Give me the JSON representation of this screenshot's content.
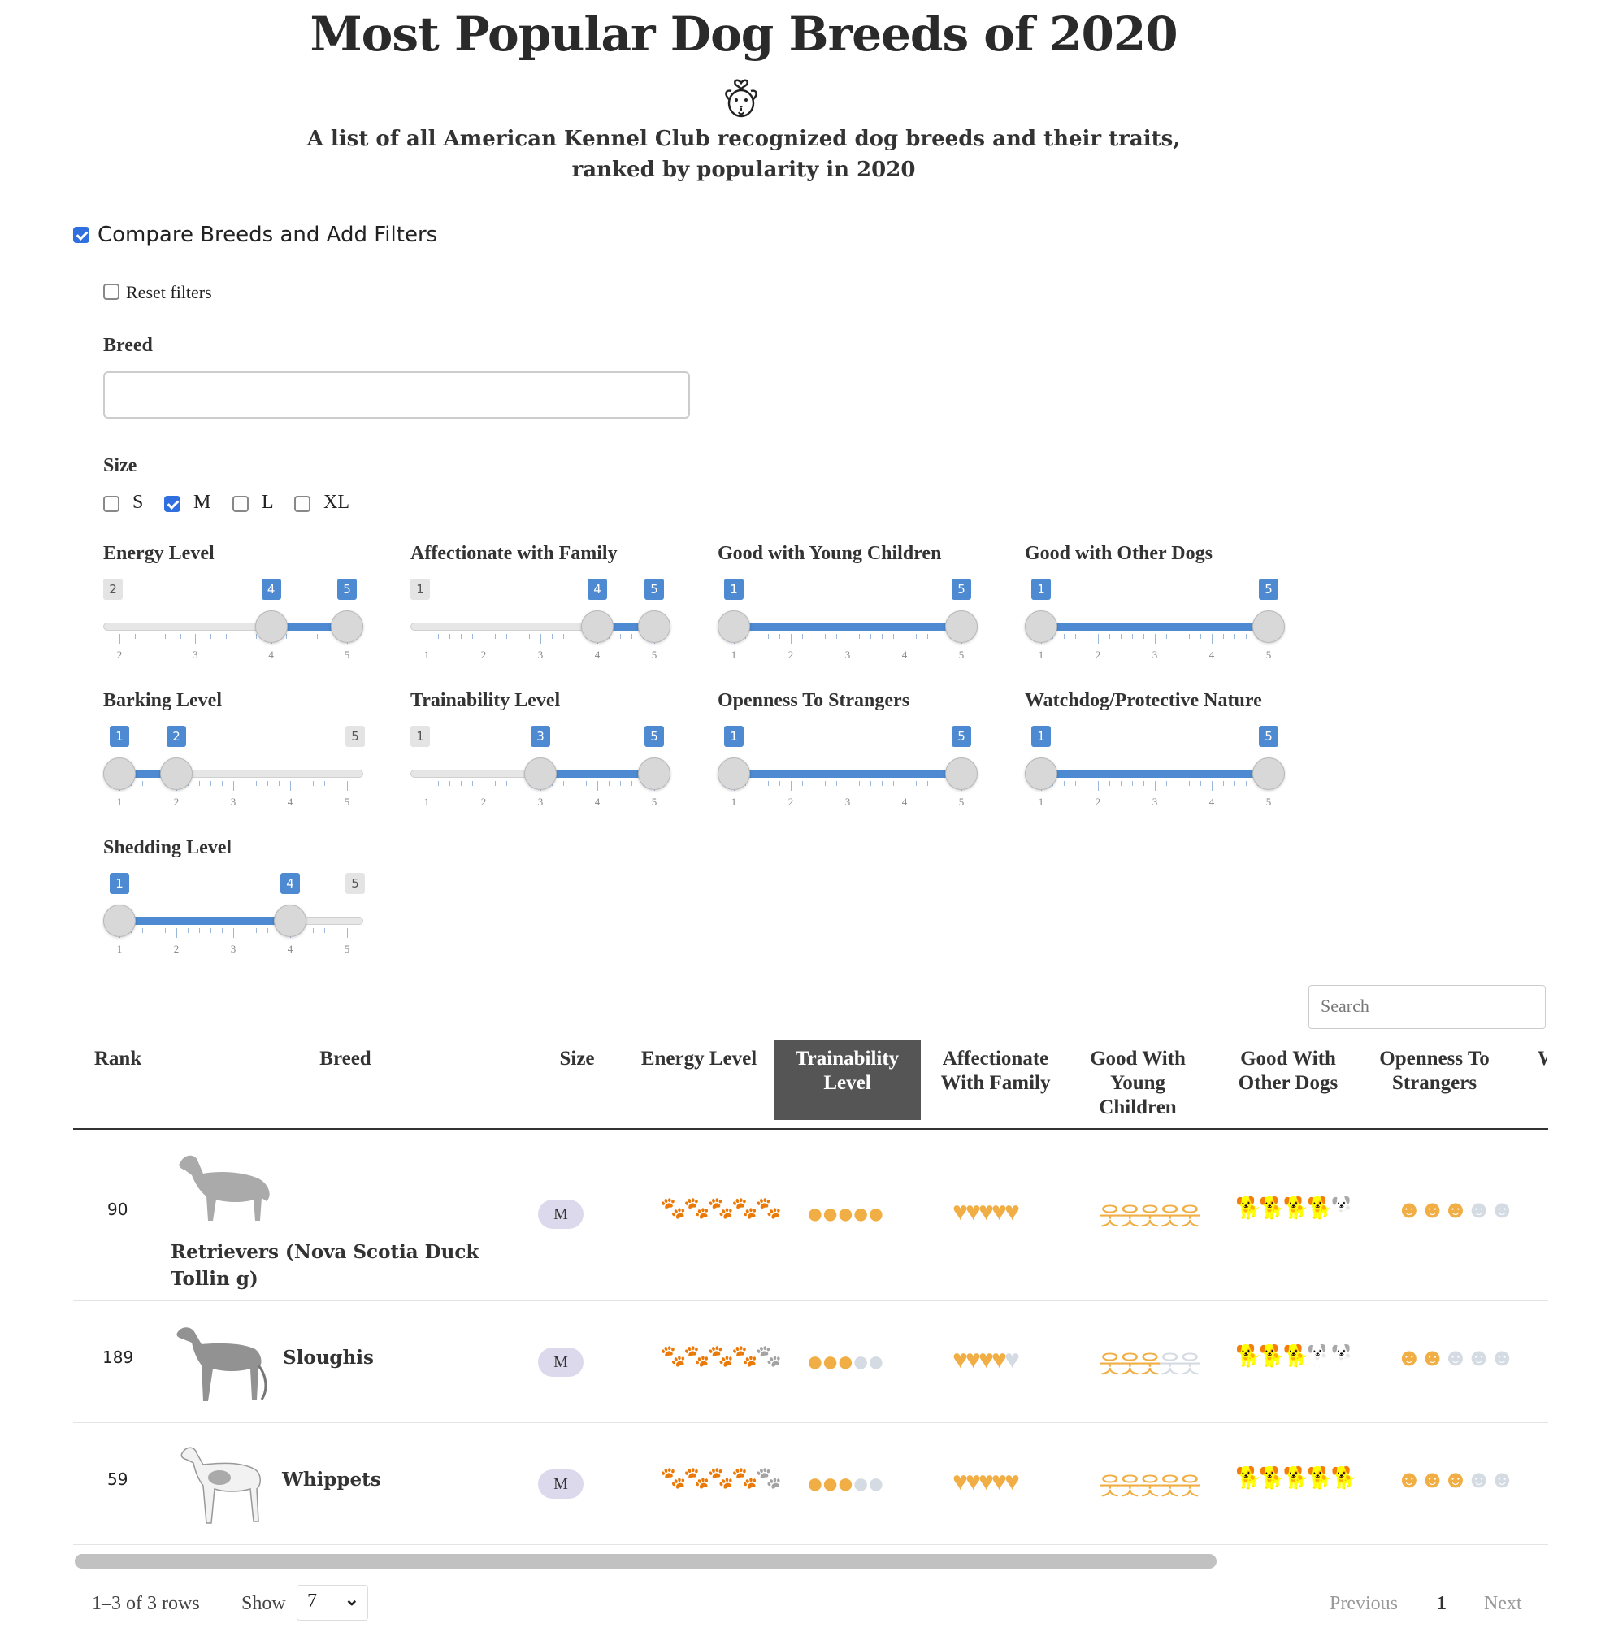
{
  "title": "Most Popular Dog Breeds of 2020",
  "subtitle_line1": "A list of all American Kennel Club recognized dog breeds and their traits,",
  "subtitle_line2": "ranked by popularity in 2020",
  "logo_icon": "dog-heart-icon",
  "compare": {
    "label": "Compare Breeds and Add Filters",
    "checked": true
  },
  "reset": {
    "label": "Reset filters",
    "checked": false
  },
  "breed_filter": {
    "label": "Breed",
    "value": ""
  },
  "size_filter": {
    "label": "Size",
    "options": [
      {
        "label": "S",
        "checked": false
      },
      {
        "label": "M",
        "checked": true
      },
      {
        "label": "L",
        "checked": false
      },
      {
        "label": "XL",
        "checked": false
      }
    ]
  },
  "sliders": [
    {
      "label": "Energy Level",
      "min": 2,
      "max": 5,
      "low": 4,
      "high": 5,
      "ticks": [
        "2",
        "3",
        "4",
        "5"
      ]
    },
    {
      "label": "Affectionate with Family",
      "min": 1,
      "max": 5,
      "low": 4,
      "high": 5,
      "ticks": [
        "1",
        "2",
        "3",
        "4",
        "5"
      ]
    },
    {
      "label": "Good with Young Children",
      "min": 1,
      "max": 5,
      "low": 1,
      "high": 5,
      "ticks": [
        "1",
        "2",
        "3",
        "4",
        "5"
      ]
    },
    {
      "label": "Good with Other Dogs",
      "min": 1,
      "max": 5,
      "low": 1,
      "high": 5,
      "ticks": [
        "1",
        "2",
        "3",
        "4",
        "5"
      ]
    },
    {
      "label": "Barking Level",
      "min": 1,
      "max": 5,
      "low": 1,
      "high": 2,
      "ticks": [
        "1",
        "2",
        "3",
        "4",
        "5"
      ]
    },
    {
      "label": "Trainability Level",
      "min": 1,
      "max": 5,
      "low": 3,
      "high": 5,
      "ticks": [
        "1",
        "2",
        "3",
        "4",
        "5"
      ]
    },
    {
      "label": "Openness To Strangers",
      "min": 1,
      "max": 5,
      "low": 1,
      "high": 5,
      "ticks": [
        "1",
        "2",
        "3",
        "4",
        "5"
      ]
    },
    {
      "label": "Watchdog/Protective Nature",
      "min": 1,
      "max": 5,
      "low": 1,
      "high": 5,
      "ticks": [
        "1",
        "2",
        "3",
        "4",
        "5"
      ]
    },
    {
      "label": "Shedding Level",
      "min": 1,
      "max": 5,
      "low": 1,
      "high": 4,
      "ticks": [
        "1",
        "2",
        "3",
        "4",
        "5"
      ]
    }
  ],
  "table": {
    "search_placeholder": "Search",
    "headers": {
      "rank": "Rank",
      "breed": "Breed",
      "size": "Size",
      "energy": "Energy Level",
      "trainability": "Trainability Level",
      "affectionate": "Affectionate With Family",
      "children": "Good With Young Children",
      "dogs": "Good With Other Dogs",
      "strangers": "Openness To Strangers",
      "watchdog_partial": "W"
    },
    "sorted_column": "trainability",
    "rows": [
      {
        "rank": "90",
        "breed": "Retrievers (Nova Scotia Duck Tollin g)",
        "size": "M",
        "energy": 5,
        "trainability": 5,
        "affectionate": 5,
        "children": 5,
        "dogs": 4,
        "strangers": 3,
        "image_icon": "retriever-dog-image"
      },
      {
        "rank": "189",
        "breed": "Sloughis",
        "size": "M",
        "energy": 4,
        "trainability": 3,
        "affectionate": 4,
        "children": 3,
        "dogs": 3,
        "strangers": 2,
        "image_icon": "sloughi-dog-image"
      },
      {
        "rank": "59",
        "breed": "Whippets",
        "size": "M",
        "energy": 4,
        "trainability": 3,
        "affectionate": 5,
        "children": 5,
        "dogs": 5,
        "strangers": 3,
        "image_icon": "whippet-dog-image"
      }
    ]
  },
  "rating_symbols": {
    "energy": "paw-icon",
    "trainability": "circle-icon",
    "affectionate": "heart-icon",
    "children": "child-figure-icon",
    "dogs": "dog-icon",
    "strangers": "smiley-icon"
  },
  "colors": {
    "accent": "#4d8ad1",
    "rating_on": "#f0ae44",
    "rating_off": "#d5dbe2",
    "size_pill": "#ddd9ec",
    "active_header": "#555555"
  },
  "footer": {
    "rows_text": "1–3 of 3 rows",
    "show_label": "Show",
    "page_size": "7",
    "previous": "Previous",
    "page": "1",
    "next": "Next"
  }
}
